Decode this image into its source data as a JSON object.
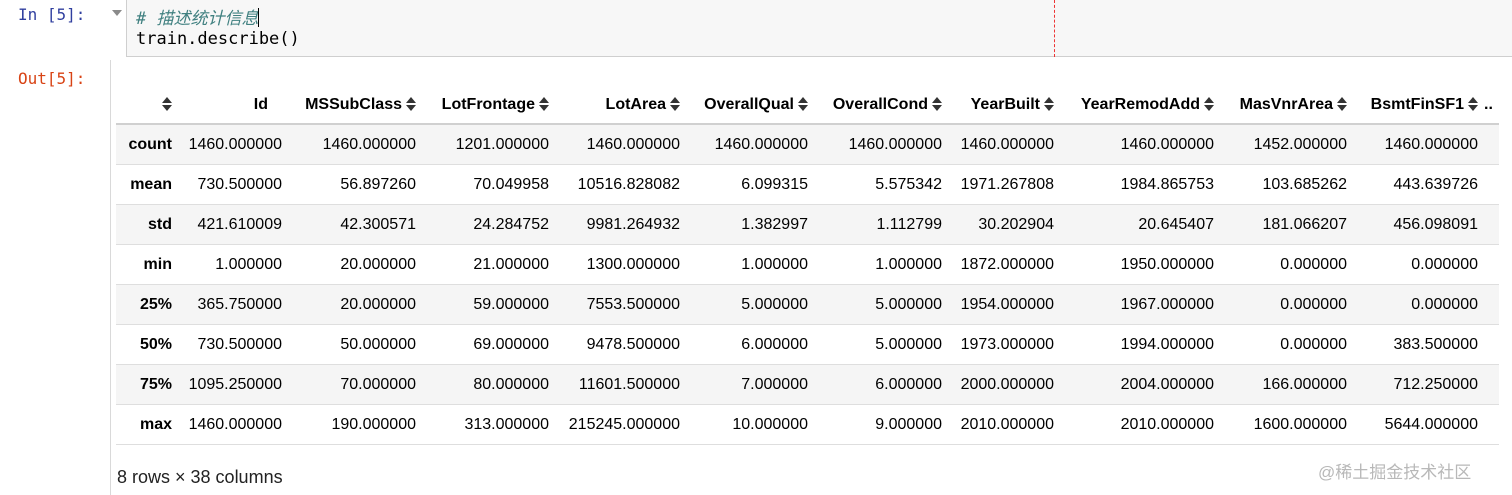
{
  "cell": {
    "in_prompt": "In [5]:",
    "out_prompt": "Out[5]:",
    "code": {
      "comment": "# 描述统计信息",
      "line2": "train.describe()"
    }
  },
  "table": {
    "columns": [
      "Id",
      "MSSubClass",
      "LotFrontage",
      "LotArea",
      "OverallQual",
      "OverallCond",
      "YearBuilt",
      "YearRemodAdd",
      "MasVnrArea",
      "BsmtFinSF1"
    ],
    "ellipsis": "..",
    "rows": [
      {
        "label": "count",
        "values": [
          "1460.000000",
          "1460.000000",
          "1201.000000",
          "1460.000000",
          "1460.000000",
          "1460.000000",
          "1460.000000",
          "1460.000000",
          "1452.000000",
          "1460.000000"
        ]
      },
      {
        "label": "mean",
        "values": [
          "730.500000",
          "56.897260",
          "70.049958",
          "10516.828082",
          "6.099315",
          "5.575342",
          "1971.267808",
          "1984.865753",
          "103.685262",
          "443.639726"
        ]
      },
      {
        "label": "std",
        "values": [
          "421.610009",
          "42.300571",
          "24.284752",
          "9981.264932",
          "1.382997",
          "1.112799",
          "30.202904",
          "20.645407",
          "181.066207",
          "456.098091"
        ]
      },
      {
        "label": "min",
        "values": [
          "1.000000",
          "20.000000",
          "21.000000",
          "1300.000000",
          "1.000000",
          "1.000000",
          "1872.000000",
          "1950.000000",
          "0.000000",
          "0.000000"
        ]
      },
      {
        "label": "25%",
        "values": [
          "365.750000",
          "20.000000",
          "59.000000",
          "7553.500000",
          "5.000000",
          "5.000000",
          "1954.000000",
          "1967.000000",
          "0.000000",
          "0.000000"
        ]
      },
      {
        "label": "50%",
        "values": [
          "730.500000",
          "50.000000",
          "69.000000",
          "9478.500000",
          "6.000000",
          "5.000000",
          "1973.000000",
          "1994.000000",
          "0.000000",
          "383.500000"
        ]
      },
      {
        "label": "75%",
        "values": [
          "1095.250000",
          "70.000000",
          "80.000000",
          "11601.500000",
          "7.000000",
          "6.000000",
          "2000.000000",
          "2004.000000",
          "166.000000",
          "712.250000"
        ]
      },
      {
        "label": "max",
        "values": [
          "1460.000000",
          "190.000000",
          "313.000000",
          "215245.000000",
          "10.000000",
          "9.000000",
          "2010.000000",
          "2010.000000",
          "1600.000000",
          "5644.000000"
        ]
      }
    ],
    "shape_text": "8 rows × 38 columns"
  },
  "watermark": "@稀土掘金技术社区",
  "icons": {
    "collapse": "chevron-down-icon",
    "sort": "sort-icon"
  }
}
